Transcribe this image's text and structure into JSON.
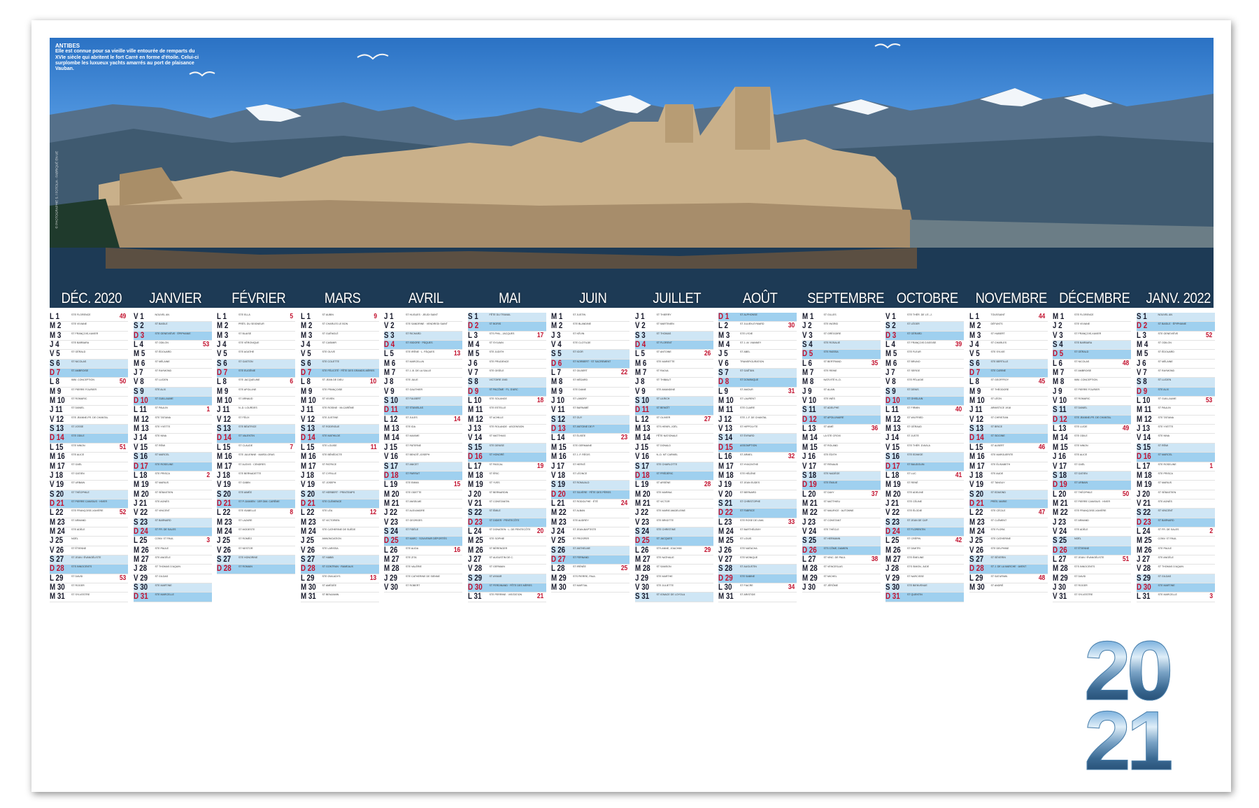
{
  "caption": {
    "title": "ANTIBES",
    "text": "Elle est connue pour sa vieille ville entourée de remparts du XVIe siècle qui abritent le fort Carré en forme d'étoile. Celui-ci surplombe les luxueux yachts amarrés au port de plaisance Vauban."
  },
  "credit": "© PHOTOGRAPHIE S. / FOTOLIA · FABRIQUÉ EN UE",
  "year": {
    "top": "20",
    "bottom": "21"
  },
  "colors": {
    "weekend": "#cfe6f5",
    "sunday": "#9fd0ef",
    "week_number": "#c2122f",
    "holiday": "#c2122f"
  },
  "months": [
    {
      "name": "DÉC. 2020",
      "start": 1,
      "days": 31,
      "wkStart": 49,
      "saints": [
        "STE FLORENCE",
        "STE VIVIANE",
        "ST FRANÇOIS-XAVIER",
        "STE BARBARA",
        "ST GÉRALD",
        "ST NICOLAS",
        "ST AMBROISE",
        "IMM. CONCEPTION",
        "ST PIERRE FOURIER",
        "ST ROMARIC",
        "ST DANIEL",
        "STE JEANNE-FR. DE CHANTAL",
        "ST JOSSE",
        "STE ODILE",
        "STE NINON",
        "STE ALICE",
        "ST GAËL",
        "ST GATIEN",
        "ST URBAIN",
        "ST THÉOPHILE",
        "ST PIERRE CANISIUS · HIVER",
        "STE FRANÇOISE-XAVIÈRE",
        "ST ARMAND",
        "STE ADÈLE",
        "NOËL",
        "ST ÉTIENNE",
        "ST JEAN / ÉVANGÉLISTE",
        "STS INNOCENTS",
        "ST DAVID",
        "ST ROGER",
        "ST SYLVESTRE"
      ]
    },
    {
      "name": "JANVIER",
      "start": 5,
      "days": 31,
      "wkStart": 53,
      "saints": [
        "NOUVEL AN",
        "ST BASILE",
        "STE GENEVIÈVE · ÉPIPHANIE",
        "ST ODILON",
        "ST ÉDOUARD",
        "ST MÉLAINE",
        "ST RAYMOND",
        "ST LUCIEN",
        "STE ALIX",
        "ST GUILLAUME",
        "ST PAULIN",
        "STE TATIANA",
        "STE YVETTE",
        "STE NINA",
        "ST RÉMI",
        "ST MARCEL",
        "STE ROSELINE",
        "STE PRISCA",
        "ST MARIUS",
        "ST SÉBASTIEN",
        "STE AGNÈS",
        "ST VINCENT",
        "ST BARNARD",
        "ST FR. DE SALES",
        "CONV. ST PAUL",
        "STE PAULE",
        "STE ANGÈLE",
        "ST THOMAS D'AQUIN",
        "ST GILDAS",
        "STE MARTINE",
        "STE MARCELLE"
      ]
    },
    {
      "name": "FÉVRIER",
      "start": 1,
      "days": 28,
      "wkStart": 5,
      "saints": [
        "STE ELLA",
        "PRÉS. DU SEIGNEUR",
        "ST BLAISE",
        "STE VÉRONIQUE",
        "STE AGATHE",
        "ST GASTON",
        "STE EUGÉNIE",
        "STE JACQUELINE",
        "STE APOLLINE",
        "ST ARNAUD",
        "N.-D. LOURDES",
        "ST FÉLIX",
        "STE BÉATRICE",
        "ST VALENTIN",
        "ST CLAUDE",
        "STE JULIENNE · MARDI-GRAS",
        "ST ALEXIS · CENDRES",
        "STE BERNADETTE",
        "ST GABIN",
        "STE AIMÉE",
        "ST P.-DAMIEN · 1ER DIM. CARÊME",
        "STE ISABELLE",
        "ST LAZARE",
        "ST MODESTE",
        "ST ROMÉO",
        "ST NESTOR",
        "STE HONORINE",
        "ST ROMAIN"
      ]
    },
    {
      "name": "MARS",
      "start": 1,
      "days": 31,
      "wkStart": 9,
      "saints": [
        "ST AUBIN",
        "ST CHARLES LE BON",
        "ST GUÉNOLÉ",
        "ST CASIMIR",
        "STE OLIVE",
        "STE COLETTE",
        "STE FÉLICITÉ · FÊTE DES GRANDS-MÈRES",
        "ST JEAN DE DIEU",
        "STE FRANÇOISE",
        "ST VIVIEN",
        "STE ROSINE · MI-CARÊME",
        "STE JUSTINE",
        "ST RODRIGUE",
        "STE MATHILDE",
        "STE LOUISE",
        "STE BÉNÉDICTE",
        "ST PATRICE",
        "ST CYRILLE",
        "ST JOSEPH",
        "ST HERBERT · PRINTEMPS",
        "STE CLÉMENCE",
        "STE LÉA",
        "ST VICTORIEN",
        "STE CATHERINE DE SUÈDE",
        "ANNONCIATION",
        "STE LARISSA",
        "ST HABIB",
        "ST GONTRAN · RAMEAUX",
        "STE GWLADYS",
        "ST AMÉDÉE",
        "ST BENJAMIN"
      ]
    },
    {
      "name": "AVRIL",
      "start": 4,
      "days": 30,
      "wkStart": 13,
      "saints": [
        "ST HUGUES · JEUDI SAINT",
        "STE SANDRINE · VENDREDI SAINT",
        "ST RICHARD",
        "ST ISIDORE · PÂQUES",
        "STE IRÈNE · L. PÂQUES",
        "ST MARCELLIN",
        "ST J.-B. DE LA SALLE",
        "STE JULIE",
        "ST GAUTHIER",
        "ST FULBERT",
        "ST STANISLAS",
        "ST JULES",
        "STE IDA",
        "ST MAXIME",
        "ST PATERNE",
        "ST BENOÎT-JOSEPH",
        "ST ANICET",
        "ST PARFAIT",
        "STE EMMA",
        "STE ODETTE",
        "ST ANSELME",
        "ST ALEXANDRE",
        "ST GEORGES",
        "ST FIDÈLE",
        "ST MARC · SOUVENIR DÉPORTÉS",
        "STE ALIDA",
        "STE ZITA",
        "STE VALÉRIE",
        "STE CATHERINE DE SIENNE",
        "ST ROBERT"
      ]
    },
    {
      "name": "MAI",
      "start": 6,
      "days": 31,
      "wkStart": 17,
      "saints": [
        "FÊTE DU TRAVAIL",
        "ST BORIS",
        "STS PHIL., JACQUES",
        "ST SYLVAIN",
        "STE JUDITH",
        "STE PRUDENCE",
        "STE GISÈLE",
        "VICTOIRE 1945",
        "ST PACÔME · FL. D'ARC",
        "STE SOLANGE",
        "STE ESTELLE",
        "ST ACHILLE",
        "STE ROLANDE · ASCENSION",
        "ST MATTHIAS",
        "STE DENISE",
        "ST HONORÉ",
        "ST PASCAL",
        "ST ÉRIC",
        "ST YVES",
        "ST BERNARDIN",
        "ST CONSTANTIN",
        "ST ÉMILE",
        "ST DIDIER · PENTECÔTE",
        "ST DONATIEN · L. DE PENTECÔTE",
        "STE SOPHIE",
        "ST BÉRENGER",
        "ST AUGUSTIN DE C.",
        "ST GERMAIN",
        "ST AYMAR",
        "ST FERDINAND · FÊTE DES MÈRES",
        "STE PERRINE · VISITATION"
      ]
    },
    {
      "name": "JUIN",
      "start": 2,
      "days": 30,
      "wkStart": 22,
      "saints": [
        "ST JUSTIN",
        "STE BLANDINE",
        "ST KÉVIN",
        "STE CLOTILDE",
        "ST IGOR",
        "ST NORBERT · ST SACREMENT",
        "ST GILBERT",
        "ST MÉDARD",
        "STE DIANE",
        "ST LANDRY",
        "ST BARNABÉ",
        "ST GUY",
        "ST ANTOINE DE P.",
        "ST ÉLISÉE",
        "STE GERMAINE",
        "ST J.-F. RÉGIS",
        "ST HERVÉ",
        "ST LÉONCE",
        "ST ROMUALD",
        "ST SILVÈRE · FÊTE DES PÈRES",
        "ST RODOLPHE · ÉTÉ",
        "ST ALBAN",
        "STE AUDREY",
        "ST JEAN-BAPTISTE",
        "ST PROSPER",
        "ST ANTHELME",
        "ST FERNAND",
        "ST IRÉNÉE",
        "STS PIERRE, PAUL",
        "ST MARTIAL"
      ]
    },
    {
      "name": "JUILLET",
      "start": 4,
      "days": 31,
      "wkStart": 26,
      "saints": [
        "ST THIERRY",
        "ST MARTINIEN",
        "ST THOMAS",
        "ST FLORENT",
        "ST ANTOINE",
        "STE MARIETTE",
        "ST RAOUL",
        "ST THIBAUT",
        "STE AMANDINE",
        "ST ULRICH",
        "ST BENOÎT",
        "ST OLIVIER",
        "STS HENRI, JOËL",
        "FÊTE NATIONALE",
        "ST DONALD",
        "N.-D. MT CARMEL",
        "STE CHARLOTTE",
        "ST FRÉDÉRIC",
        "ST ARSÈNE",
        "STE MARINA",
        "ST VICTOR",
        "STE MARIE-MADELEINE",
        "STE BRIGITTE",
        "STE CHRISTINE",
        "ST JACQUES",
        "STS ANNE, JOACHIM",
        "STE NATHALIE",
        "ST SAMSON",
        "STE MARTHE",
        "STE JULIETTE",
        "ST IGNACE DE LOYOLA"
      ]
    },
    {
      "name": "AOÛT",
      "start": 7,
      "days": 31,
      "wkStart": 30,
      "saints": [
        "ST ALPHONSE",
        "ST JULIEN-EYMARD",
        "STE LYDIE",
        "ST J.-M. VIANNEY",
        "ST ABEL",
        "TRANSFIGURATION",
        "ST GAÉTAN",
        "ST DOMINIQUE",
        "ST AMOUR",
        "ST LAURENT",
        "STE CLAIRE",
        "STE J.-F. DE CHANTAL",
        "ST HIPPOLYTE",
        "ST ÉVRARD",
        "ASSOMPTION",
        "ST ARMEL",
        "ST HYACINTHE",
        "STE HÉLÈNE",
        "ST JEAN EUDES",
        "ST BERNARD",
        "ST CHRISTOPHE",
        "ST FABRICE",
        "STE ROSE DE LIMA",
        "ST BARTHÉLEMY",
        "ST LOUIS",
        "STE NATACHA",
        "STE MONIQUE",
        "ST AUGUSTIN",
        "STE SABINE",
        "ST FIACRE",
        "ST ARISTIDE"
      ]
    },
    {
      "name": "SEPTEMBRE",
      "start": 3,
      "days": 30,
      "wkStart": 35,
      "saints": [
        "ST GILLES",
        "STE INGRID",
        "ST GRÉGOIRE",
        "STE ROSALIE",
        "STE RAÏSSA",
        "ST BERTRAND",
        "STE REINE",
        "NATIVITÉ N.-D.",
        "ST ALAIN",
        "STE INÈS",
        "ST ADELPHE",
        "ST APOLLINAIRE",
        "ST AIMÉ",
        "LA STE CROIX",
        "ST ROLAND",
        "STE ÉDITH",
        "ST RENAUD",
        "STE NADÈGE",
        "STE ÉMILIE",
        "ST DAVY",
        "ST MATTHIEU",
        "ST MAURICE · AUTOMNE",
        "ST CONSTANT",
        "STE THÈCLE",
        "ST HERMANN",
        "STS CÔME, DAMIEN",
        "ST VINC. DE PAUL",
        "ST VENCESLAS",
        "ST MICHEL",
        "ST JÉRÔME"
      ]
    },
    {
      "name": "OCTOBRE",
      "start": 5,
      "days": 31,
      "wkStart": 39,
      "saints": [
        "STE THÉR. DE L'E.-J.",
        "ST LÉGER",
        "ST GÉRARD",
        "ST FRANÇOIS D'ASSISE",
        "STE FLEUR",
        "ST BRUNO",
        "ST SERGE",
        "STE PÉLAGIE",
        "ST DENIS",
        "ST GHISLAIN",
        "ST FIRMIN",
        "ST WILFRIED",
        "ST GÉRAUD",
        "ST JUSTE",
        "STE THÉR. D'AVILA",
        "STE EDWIGE",
        "ST BAUDOUIN",
        "ST LUC",
        "ST RENÉ",
        "STE ADELINE",
        "STE CÉLINE",
        "STE ÉLODIE",
        "ST JEAN DE CAP.",
        "ST FLORENTIN",
        "ST CRÉPIN",
        "ST DIMITRI",
        "STE ÉMELINE",
        "STS SIMON, JUDE",
        "ST NARCISSE",
        "STE BIENVENUE",
        "ST QUENTIN"
      ]
    },
    {
      "name": "NOVEMBRE",
      "start": 1,
      "days": 30,
      "wkStart": 44,
      "saints": [
        "TOUSSAINT",
        "DÉFUNTS",
        "ST HUBERT",
        "ST CHARLES",
        "STE SYLVIE",
        "STE BERTILLE",
        "STE CARINE",
        "ST GEOFFROY",
        "ST THÉODORE",
        "ST LÉON",
        "ARMISTICE 1918",
        "ST CHRISTIAN",
        "ST BRICE",
        "ST SIDOINE",
        "ST ALBERT",
        "STE MARGUERITE",
        "STE ÉLISABETH",
        "STE AUDE",
        "ST TANGUY",
        "ST EDMOND",
        "PRÉS. MARIE",
        "STE CÉCILE",
        "ST CLÉMENT",
        "STE FLORA",
        "STE CATHERINE",
        "STE DELPHINE",
        "ST SÉVERIN",
        "ST J. DE LA MARCHE · AVENT",
        "ST SATURNIN",
        "ST ANDRÉ"
      ]
    },
    {
      "name": "DÉCEMBRE",
      "start": 3,
      "days": 31,
      "wkStart": 48,
      "saints": [
        "STE FLORENCE",
        "STE VIVIANE",
        "ST FRANÇOIS-XAVIER",
        "STE BARBARA",
        "ST GÉRALD",
        "ST NICOLAS",
        "ST AMBROISE",
        "IMM. CONCEPTION",
        "ST PIERRE FOURIER",
        "ST ROMARIC",
        "ST DANIEL",
        "STE JEANNE-FR. DE CHANTAL",
        "STE LUCIE",
        "STE ODILE",
        "STE NINON",
        "STE ALICE",
        "ST GAËL",
        "ST GATIEN",
        "ST URBAIN",
        "ST THÉOPHILE",
        "ST PIERRE CANISIUS · HIVER",
        "STE FRANÇOISE-XAVIÈRE",
        "ST ARMAND",
        "STE ADÈLE",
        "NOËL",
        "ST ÉTIENNE",
        "ST JEAN / ÉVANGÉLISTE",
        "STS INNOCENTS",
        "ST DAVID",
        "ST ROGER",
        "ST SYLVESTRE"
      ]
    },
    {
      "name": "JANV. 2022",
      "start": 6,
      "days": 31,
      "wkStart": 52,
      "saints": [
        "NOUVEL AN",
        "ST BASILE · ÉPIPHANIE",
        "STE GENEVIÈVE",
        "ST ODILON",
        "ST ÉDOUARD",
        "ST MÉLAINE",
        "ST RAYMOND",
        "ST LUCIEN",
        "STE ALIX",
        "ST GUILLAUME",
        "ST PAULIN",
        "STE TATIANA",
        "STE YVETTE",
        "STE NINA",
        "ST RÉMI",
        "ST MARCEL",
        "STE ROSELINE",
        "STE PRISCA",
        "ST MARIUS",
        "ST SÉBASTIEN",
        "STE AGNÈS",
        "ST VINCENT",
        "ST BARNARD",
        "ST FR. DE SALES",
        "CONV. ST PAUL",
        "STE PAULE",
        "STE ANGÈLE",
        "ST THOMAS D'AQUIN",
        "ST GILDAS",
        "STE MARTINE",
        "STE MARCELLE"
      ]
    }
  ],
  "day_letters": [
    "L",
    "M",
    "M",
    "J",
    "V",
    "S",
    "D"
  ]
}
